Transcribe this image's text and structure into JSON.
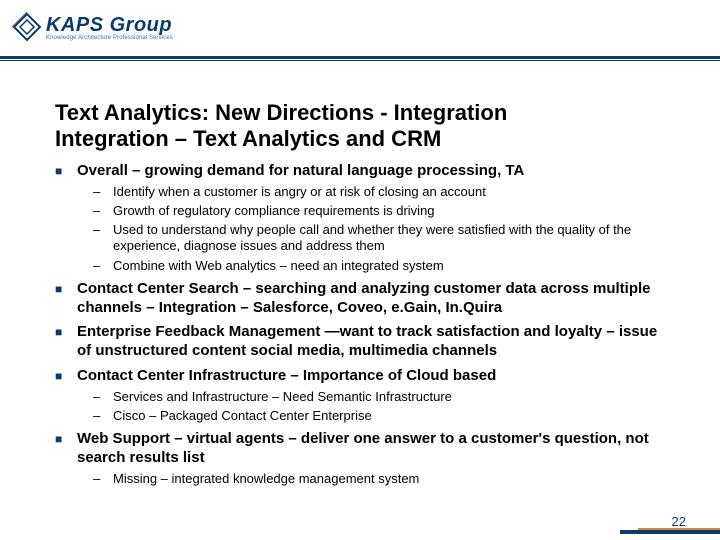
{
  "logo": {
    "text": "KAPS Group",
    "tagline": "Knowledge Architecture Professional Services"
  },
  "title1": "Text Analytics: New Directions - Integration",
  "title2": "Integration – Text Analytics and CRM",
  "bullets": [
    {
      "level": 1,
      "text": "Overall – growing demand for natural language processing, TA"
    },
    {
      "level": 2,
      "text": "Identify when a customer is angry or at risk of closing an account"
    },
    {
      "level": 2,
      "text": "Growth of regulatory compliance requirements is driving"
    },
    {
      "level": 2,
      "text": "Used to understand why people call and whether they were satisfied  with the quality of the experience, diagnose issues and address them"
    },
    {
      "level": 2,
      "text": "Combine with Web analytics – need an integrated system"
    },
    {
      "level": 1,
      "text": "Contact Center Search – searching and analyzing customer data across multiple channels – Integration – Salesforce, Coveo, e.Gain, In.Quira"
    },
    {
      "level": 1,
      "text": "Enterprise Feedback Management —want to track satisfaction and loyalty – issue of unstructured content social media, multimedia channels"
    },
    {
      "level": 1,
      "text": "Contact Center Infrastructure – Importance of Cloud based"
    },
    {
      "level": 2,
      "text": "Services and Infrastructure – Need Semantic Infrastructure"
    },
    {
      "level": 2,
      "text": "Cisco – Packaged Contact Center Enterprise"
    },
    {
      "level": 1,
      "text": "Web Support – virtual agents – deliver one answer to a customer's question, not search results list"
    },
    {
      "level": 2,
      "text": "Missing – integrated knowledge management system"
    }
  ],
  "page_number": "22"
}
